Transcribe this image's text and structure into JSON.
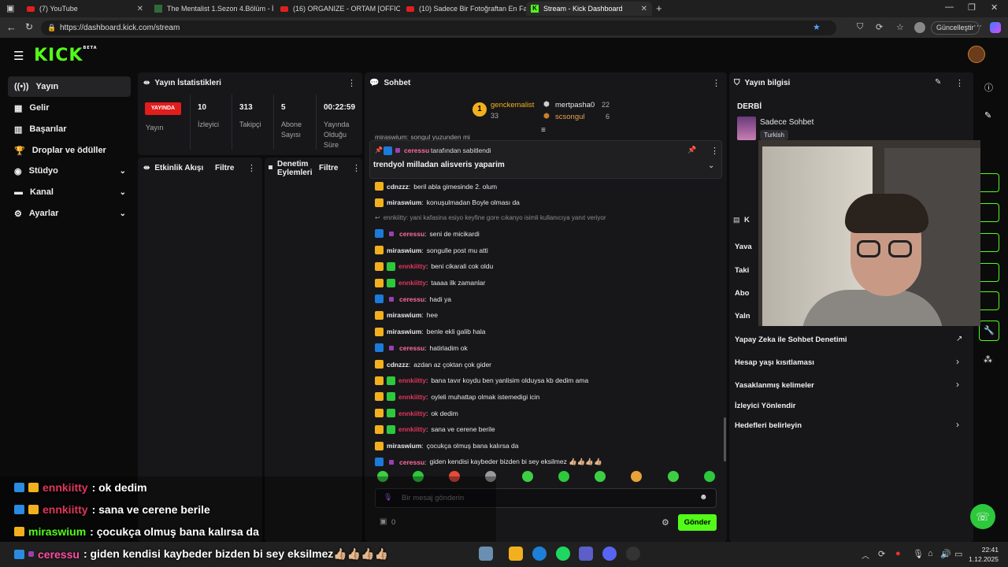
{
  "browser": {
    "tabs": [
      {
        "title": "(7) YouTube",
        "icon": "youtube-icon"
      },
      {
        "title": "The Mentalist 1.Sezon 4.Bölüm - İ",
        "icon": "site-icon"
      },
      {
        "title": "(16) ORGANIZE - ORTAM [OFFICIA",
        "icon": "youtube-icon"
      },
      {
        "title": "(10) Sadece Bir Fotoğraftan En Fa",
        "icon": "youtube-icon"
      },
      {
        "title": "Stream - Kick Dashboard",
        "icon": "kick-icon"
      }
    ],
    "url": "https://dashboard.kick.com/stream",
    "update_label": "Güncelleştir"
  },
  "app": {
    "logo": "KICK",
    "logo_beta": "BETA",
    "nav": [
      {
        "label": "Yayın",
        "icon": "broadcast-icon",
        "selected": true
      },
      {
        "label": "Gelir",
        "icon": "revenue-icon"
      },
      {
        "label": "Başarılar",
        "icon": "achievements-icon"
      },
      {
        "label": "Droplar ve ödüller",
        "icon": "trophy-icon"
      },
      {
        "label": "Stüdyo",
        "icon": "studio-icon",
        "expandable": true
      },
      {
        "label": "Kanal",
        "icon": "channel-icon",
        "expandable": true
      },
      {
        "label": "Ayarlar",
        "icon": "settings-icon",
        "expandable": true
      }
    ]
  },
  "stats": {
    "title": "Yayın İstatistikleri",
    "live_badge": "YAYINDA",
    "live_label": "Yayın",
    "viewers": {
      "value": "10",
      "label": "İzleyici"
    },
    "followers": {
      "value": "313",
      "label": "Takipçi"
    },
    "subs": {
      "value": "5",
      "label1": "Abone",
      "label2": "Sayısı"
    },
    "duration": {
      "value": "00:22:59",
      "label1": "Yayında",
      "label2": "Olduğu",
      "label3": "Süre"
    }
  },
  "activity": {
    "title": "Etkinlik Akışı",
    "filter": "Filtre"
  },
  "moderation": {
    "title1": "Denetim",
    "title2": "Eylemleri",
    "filter": "Filtre"
  },
  "chat": {
    "title": "Sohbet",
    "leaderboard": {
      "first": {
        "rank": "1",
        "name": "genckemalist",
        "value": "33"
      },
      "second": {
        "name": "mertpasha0",
        "value": "22"
      },
      "third": {
        "name": "scsongul",
        "value": "6"
      }
    },
    "partial_top": "miraswium: songul yuzunden mi",
    "pinned": {
      "by_user": "ceressu",
      "by_text": "tarafından sabitlendi",
      "message": "trendyol milladan alisveris yaparim"
    },
    "messages": [
      {
        "user": "cdnzzz",
        "text": "beril abla gimesinde 2. olum",
        "color": "#e8e8e8",
        "badges": [
          "crown"
        ]
      },
      {
        "user": "miraswium",
        "text": "konuşulmadan Boyle olması da",
        "color": "#e8e8e8",
        "badges": [
          "crown"
        ]
      },
      {
        "reply": "ennkiitty: yani kafasina esiyo keyfine gore cıkanyo isimli kullanıcıya yanıt veriyor"
      },
      {
        "user": "ceressu",
        "text": "seni de micikardi",
        "color": "#ff6b9a",
        "badges": [
          "mod",
          "purple"
        ]
      },
      {
        "user": "miraswium",
        "text": "songulle post mu atti",
        "color": "#e8e8e8",
        "badges": [
          "crown"
        ]
      },
      {
        "user": "ennkiitty",
        "text": "beni cikarali cok oldu",
        "color": "#e0365a",
        "badges": [
          "crown",
          "sub"
        ]
      },
      {
        "user": "ennkiitty",
        "text": "taaaa ilk zamanlar",
        "color": "#e0365a",
        "badges": [
          "crown",
          "sub"
        ]
      },
      {
        "user": "ceressu",
        "text": "hadi ya",
        "color": "#ff6b9a",
        "badges": [
          "mod",
          "purple"
        ]
      },
      {
        "user": "miraswium",
        "text": "hee",
        "color": "#e8e8e8",
        "badges": [
          "crown"
        ]
      },
      {
        "user": "miraswium",
        "text": "benle ekli galib hala",
        "color": "#e8e8e8",
        "badges": [
          "crown"
        ]
      },
      {
        "user": "ceressu",
        "text": "hatirladim ok",
        "color": "#ff6b9a",
        "badges": [
          "mod",
          "purple"
        ]
      },
      {
        "user": "cdnzzz",
        "text": "azdan az çoktan çok gider",
        "color": "#e8e8e8",
        "badges": [
          "crown"
        ]
      },
      {
        "user": "ennkiitty",
        "text": "bana tavır koydu ben yanlisim olduysa kb dedim ama",
        "color": "#e0365a",
        "badges": [
          "crown",
          "sub"
        ]
      },
      {
        "user": "ennkiitty",
        "text": "oyleli muhattap olmak istemedigi icin",
        "color": "#e0365a",
        "badges": [
          "crown",
          "sub"
        ]
      },
      {
        "user": "ennkiitty",
        "text": "ok dedim",
        "color": "#e0365a",
        "badges": [
          "crown",
          "sub"
        ]
      },
      {
        "user": "ennkiitty",
        "text": "sana ve cerene berile",
        "color": "#e0365a",
        "badges": [
          "crown",
          "sub"
        ]
      },
      {
        "user": "miraswium",
        "text": "çocukça olmuş bana kalırsa da",
        "color": "#e8e8e8",
        "badges": [
          "crown"
        ]
      },
      {
        "user": "ceressu",
        "text": "giden kendisi kaybeder bizden bi sey eksilmez 👍🏼👍🏼👍🏼👍🏼",
        "color": "#ff6b9a",
        "badges": [
          "mod",
          "purple"
        ]
      }
    ],
    "input_placeholder": "Bir mesaj gönderin",
    "points": "0",
    "send": "Gönder"
  },
  "info": {
    "title": "Yayın bilgisi",
    "stream_title": "DERBİ",
    "category": "Sadece Sohbet",
    "language": "Turkish",
    "section_partial": "K",
    "partial_rows": [
      "Yava",
      "Taki",
      "Abo",
      "Yaln"
    ],
    "rows": [
      {
        "label": "Yapay Zeka ile Sohbet Denetimi",
        "icon": "external-link-icon"
      },
      {
        "label": "Hesap yaşı kısıtlaması",
        "icon": "chevron-right-icon"
      },
      {
        "label": "Yasaklanmış kelimeler",
        "icon": "chevron-right-icon"
      },
      {
        "label": "İzleyici Yönlendir",
        "icon": ""
      },
      {
        "label": "Hedefleri belirleyin",
        "icon": "chevron-right-icon"
      }
    ]
  },
  "overlay": [
    {
      "user": "ennkiitty",
      "text": ": ok dedim",
      "color": "#e0365a",
      "badges": [
        "blue",
        "crown"
      ]
    },
    {
      "user": "ennkiitty",
      "text": ": sana ve cerene berile",
      "color": "#e0365a",
      "badges": [
        "blue",
        "crown"
      ]
    },
    {
      "user": "miraswium",
      "text": ": çocukça olmuş bana kalırsa da",
      "color": "#53fc18",
      "badges": [
        "crown"
      ]
    },
    {
      "user": "ceressu",
      "text": ": giden kendisi kaybeder bizden bi sey eksilmez👍🏼👍🏼👍🏼👍🏼",
      "color": "#ff4fa0",
      "badges": [
        "mod",
        "purple"
      ]
    }
  ],
  "taskbar": {
    "time": "22:41",
    "date": "1.12.2025"
  },
  "colors": {
    "kick_green": "#53fc18",
    "live_red": "#e31c1c",
    "panel": "#17171a"
  }
}
